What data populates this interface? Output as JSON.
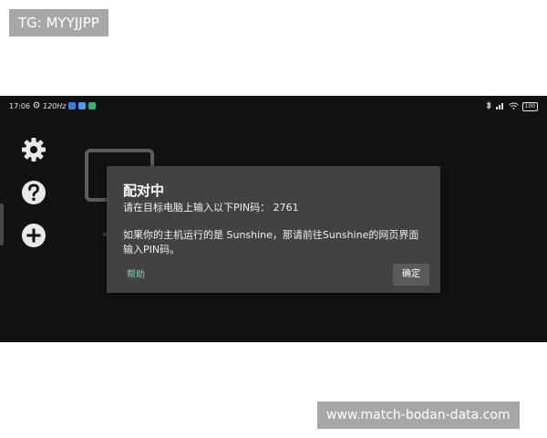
{
  "watermark": {
    "top": "TG: MYYJJPP",
    "bottom": "www.match-bodan-data.com"
  },
  "status_bar": {
    "time": "17:06",
    "refresh": "120Hz",
    "battery": "100"
  },
  "sidebar": {
    "icons": [
      "gear-icon",
      "help-icon",
      "add-icon"
    ]
  },
  "dialog": {
    "title": "配对中",
    "line1": "请在目标电脑上输入以下PIN码： 2761",
    "line2": "如果你的主机运行的是 Sunshine，那请前往Sunshine的网页界面",
    "line3": "输入PIN码。",
    "help_label": "帮助",
    "ok_label": "确定"
  },
  "colors": {
    "background": "#121212",
    "dialog": "#424242",
    "accent": "#7fd1c4"
  }
}
